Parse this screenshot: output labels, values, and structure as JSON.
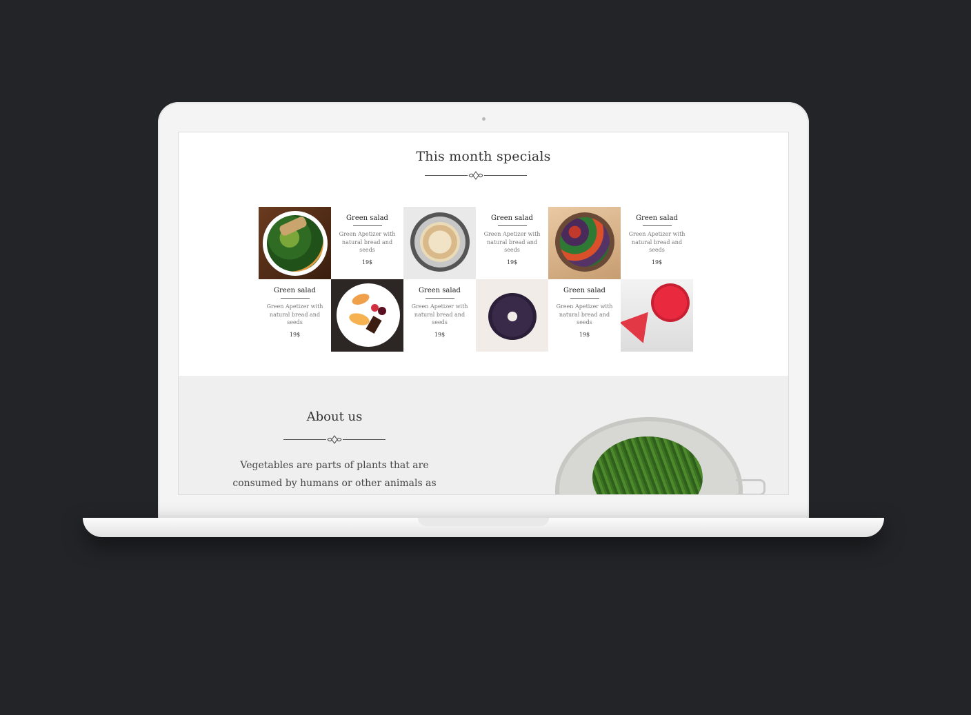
{
  "specials": {
    "title": "This month specials",
    "items": [
      {
        "name": "Green salad",
        "desc": "Green Apetizer with natural bread and seeds",
        "price": "19$"
      },
      {
        "name": "Green salad",
        "desc": "Green Apetizer with natural bread and seeds",
        "price": "19$"
      },
      {
        "name": "Green salad",
        "desc": "Green Apetizer with natural bread and seeds",
        "price": "19$"
      },
      {
        "name": "Green salad",
        "desc": "Green Apetizer with natural bread and seeds",
        "price": "19$"
      },
      {
        "name": "Green salad",
        "desc": "Green Apetizer with natural bread and seeds",
        "price": "19$"
      },
      {
        "name": "Green salad",
        "desc": "Green Apetizer with natural bread and seeds",
        "price": "19$"
      }
    ]
  },
  "about": {
    "title": "About us",
    "text": "Vegetables are parts of plants that are consumed by humans or other animals as"
  },
  "colors": {
    "page_bg": "#232427",
    "about_bg": "#eeefee"
  }
}
